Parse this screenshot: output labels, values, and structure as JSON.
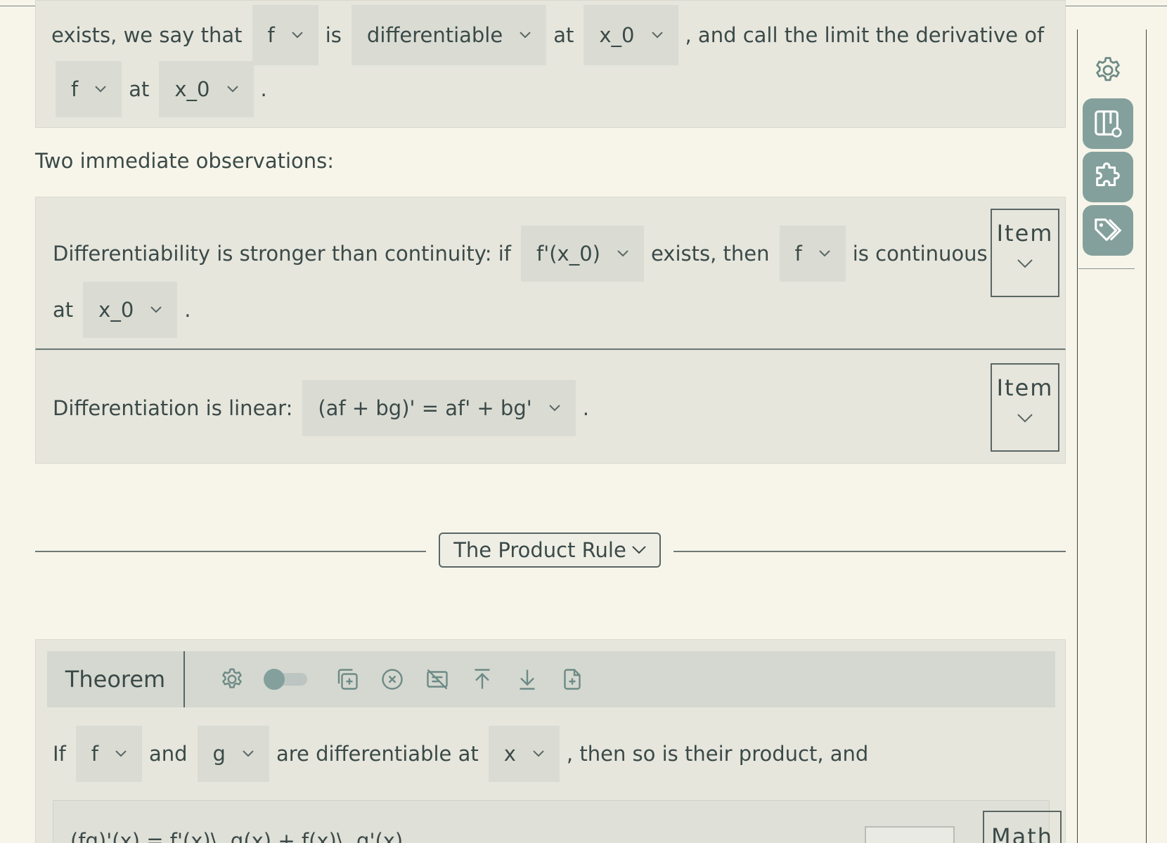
{
  "colors": {
    "accent": "#84a09c",
    "background": "#f7f5ea",
    "panel": "#e6e6dd",
    "text": "#3b4a48"
  },
  "definition": {
    "line1": {
      "t1": "exists, we say that",
      "dd1": "f",
      "t2": "is",
      "dd2": "differentiable",
      "t3": "at",
      "dd3": "x_0",
      "t4": ", and call the limit the derivative of"
    },
    "line2": {
      "dd1": "f",
      "t1": "at",
      "dd2": "x_0",
      "t2": "."
    }
  },
  "observations_heading": "Two immediate observations:",
  "item1": {
    "t1": "Differentiability is stronger than continuity: if",
    "dd1": "f'(x_0)",
    "t2": "exists, then",
    "dd2": "f",
    "t3": "is continuous",
    "t4": "at",
    "dd3": "x_0",
    "t5": ".",
    "tag": "Item"
  },
  "item2": {
    "t1": "Differentiation is linear:",
    "dd1": "(af + bg)' = af' + bg'",
    "t2": ".",
    "tag": "Item"
  },
  "section": {
    "title": "The Product Rule"
  },
  "theorem": {
    "label": "Theorem",
    "body": {
      "t1": "If",
      "dd1": "f",
      "t2": "and",
      "dd2": "g",
      "t3": "are differentiable at",
      "dd3": "x",
      "t4": ", then so is their product, and"
    },
    "formula": "(fg)'(x) = f'(x)\\, g(x) + f(x)\\, g'(x)",
    "math_tag": "Math"
  },
  "rail": {
    "icons": [
      "gear-icon",
      "layout-settings-icon",
      "puzzle-icon",
      "tags-icon"
    ]
  }
}
